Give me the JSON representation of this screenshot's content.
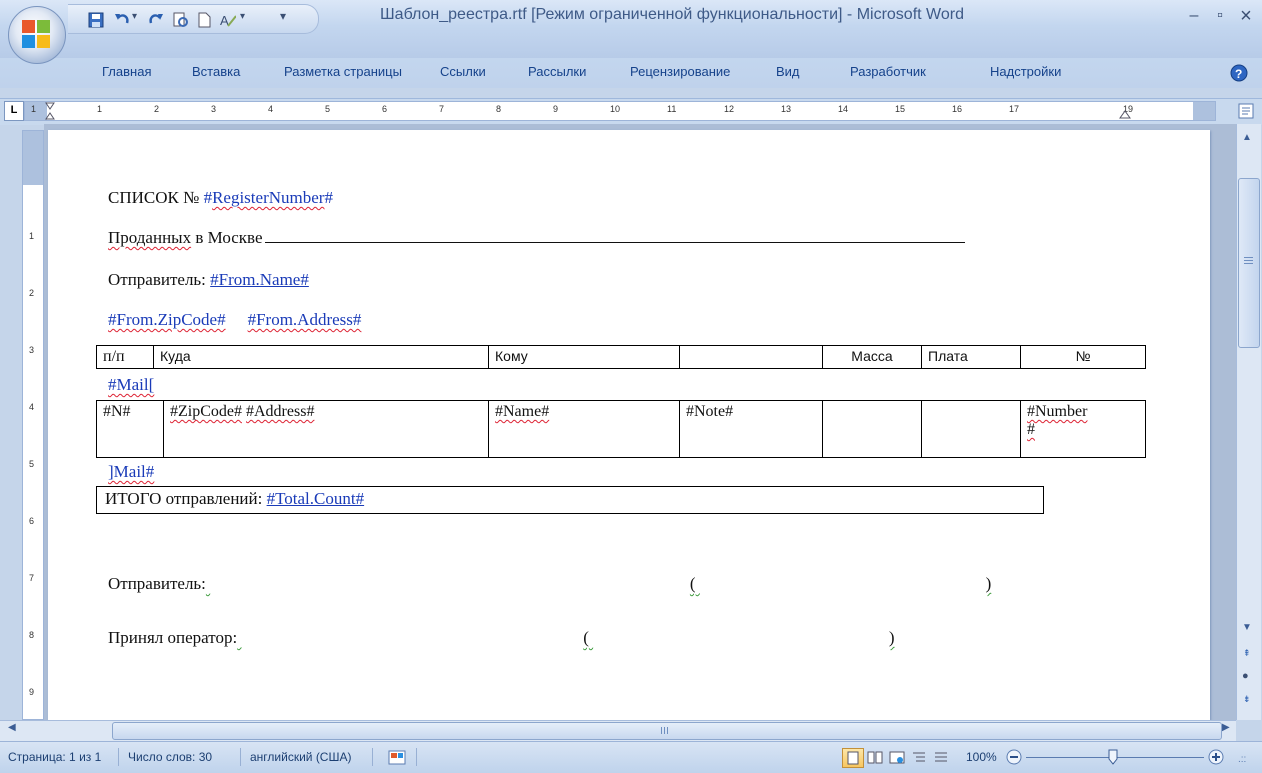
{
  "window": {
    "title": "Шаблон_реестра.rtf [Режим ограниченной функциональности] - Microsoft Word",
    "minimize": "–",
    "maximize": "▫",
    "close": "×"
  },
  "ribbon_tabs": [
    "Главная",
    "Вставка",
    "Разметка страницы",
    "Ссылки",
    "Рассылки",
    "Рецензирование",
    "Вид",
    "Разработчик",
    "Надстройки"
  ],
  "ruler": {
    "tab_selector": "L",
    "h_numbers": [
      "1",
      "1",
      "2",
      "3",
      "4",
      "5",
      "6",
      "7",
      "8",
      "9",
      "10",
      "11",
      "12",
      "13",
      "14",
      "15",
      "16",
      "17",
      "19"
    ],
    "v_numbers": [
      "1",
      "2",
      "3",
      "4",
      "5",
      "6",
      "7",
      "8",
      "9"
    ]
  },
  "document": {
    "line1_prefix": "СПИСОК № ",
    "line1_ph": "#RegisterNumber#",
    "line2_a": "Проданных",
    "line2_b": " в Москве",
    "line3_prefix": "Отправитель: ",
    "line3_ph": "#From.Name#",
    "line4_ph1": "#From.ZipCode#",
    "line4_ph2": "#From.Address#",
    "header_row": [
      "п/п",
      "Куда",
      "Кому",
      "",
      "Масса",
      "Плата",
      "№"
    ],
    "mail_open": "#Mail[",
    "data_row": {
      "n": "#N#",
      "zip": "#ZipCode#",
      "address": "#Address#",
      "name": "#Name#",
      "note": "#Note#",
      "mass": "",
      "pay": "",
      "number_a": "#Number",
      "number_b": "#"
    },
    "mail_close": "]Mail#",
    "total_prefix": "ИТОГО отправлений: ",
    "total_ph": "#Total.Count#",
    "sender_label": "Отправитель:",
    "open_paren": "(",
    "close_paren": ")",
    "operator_label": "Принял оператор:"
  },
  "status": {
    "page": "Страница: 1 из 1",
    "words": "Число слов: 30",
    "language": "английский (США)",
    "zoom": "100%",
    "zoom_level": 1.0
  }
}
